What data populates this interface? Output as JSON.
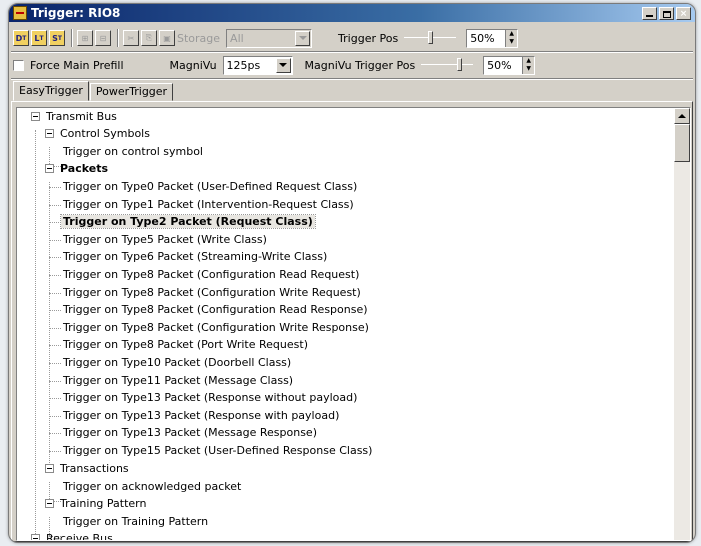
{
  "window": {
    "title": "Trigger: RIO8"
  },
  "toolbar": {
    "btn_d": "D",
    "btn_l": "L",
    "btn_s": "S",
    "storage_label": "Storage",
    "storage_combo": "All",
    "trigger_pos_label": "Trigger Pos",
    "trigger_pos_value": "50%"
  },
  "toolbar2": {
    "force_main_prefill": "Force Main Prefill",
    "magnivu_label": "MagniVu",
    "magnivu_value": "125ps",
    "magnivu_trigger_pos_label": "MagniVu Trigger Pos",
    "magnivu_trigger_pos_value": "50%"
  },
  "tabs": [
    {
      "label": "EasyTrigger",
      "active": true
    },
    {
      "label": "PowerTrigger",
      "active": false
    }
  ],
  "tree": {
    "transmit_bus": "Transmit Bus",
    "control_symbols": "Control Symbols",
    "trigger_control_symbol": "Trigger on control symbol",
    "packets": "Packets",
    "packet_items": [
      "Trigger on Type0 Packet (User-Defined Request Class)",
      "Trigger on Type1 Packet (Intervention-Request Class)",
      "Trigger on Type2 Packet (Request Class)",
      "Trigger on Type5 Packet (Write Class)",
      "Trigger on Type6 Packet (Streaming-Write Class)",
      "Trigger on Type8 Packet (Configuration Read Request)",
      "Trigger on Type8 Packet (Configuration Write Request)",
      "Trigger on Type8 Packet (Configuration Read Response)",
      "Trigger on Type8 Packet (Configuration Write Response)",
      "Trigger on Type8 Packet (Port Write Request)",
      "Trigger on Type10 Packet (Doorbell Class)",
      "Trigger on Type11 Packet (Message Class)",
      "Trigger on Type13 Packet (Response without payload)",
      "Trigger on Type13 Packet (Response with payload)",
      "Trigger on Type13 Packet (Message Response)",
      "Trigger on Type15 Packet (User-Defined Response Class)"
    ],
    "transactions": "Transactions",
    "trigger_ack_packet": "Trigger on acknowledged packet",
    "training_pattern": "Training Pattern",
    "trigger_training_pattern": "Trigger on Training Pattern",
    "receive_bus": "Receive Bus"
  }
}
